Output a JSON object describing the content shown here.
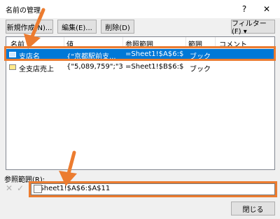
{
  "window": {
    "title": "名前の管理",
    "help_label": "?",
    "close_label": "✕"
  },
  "toolbar": {
    "new_label": "新規作成(N)...",
    "edit_label": "編集(E)...",
    "delete_label": "削除(D)",
    "filter_label": "フィルター(F) ▾"
  },
  "table": {
    "headers": [
      "名前",
      "値",
      "参照範囲",
      "範囲",
      "コメント"
    ],
    "rows": [
      {
        "icon": "named-range-icon",
        "name": "支店名",
        "value": "{\"京都駅前支...",
        "refers_to": "=Sheet1!$A$6:$...",
        "scope": "ブック",
        "comment": "",
        "selected": true
      },
      {
        "icon": "named-range-icon",
        "name": "全支店売上",
        "value": "{\"5,089,759\";\"3,...",
        "refers_to": "=Sheet1!$B$6:$...",
        "scope": "ブック",
        "comment": "",
        "selected": false
      }
    ]
  },
  "reference": {
    "label": "参照範囲(R):",
    "value": "=Sheet1!$A$6:$A$11",
    "cancel_icon": "cancel-x-icon",
    "confirm_icon": "confirm-check-icon"
  },
  "footer": {
    "close_label": "閉じる"
  },
  "colors": {
    "selection": "#0078d7",
    "highlight": "#ec7c30",
    "arrow": "#ec7c30"
  }
}
